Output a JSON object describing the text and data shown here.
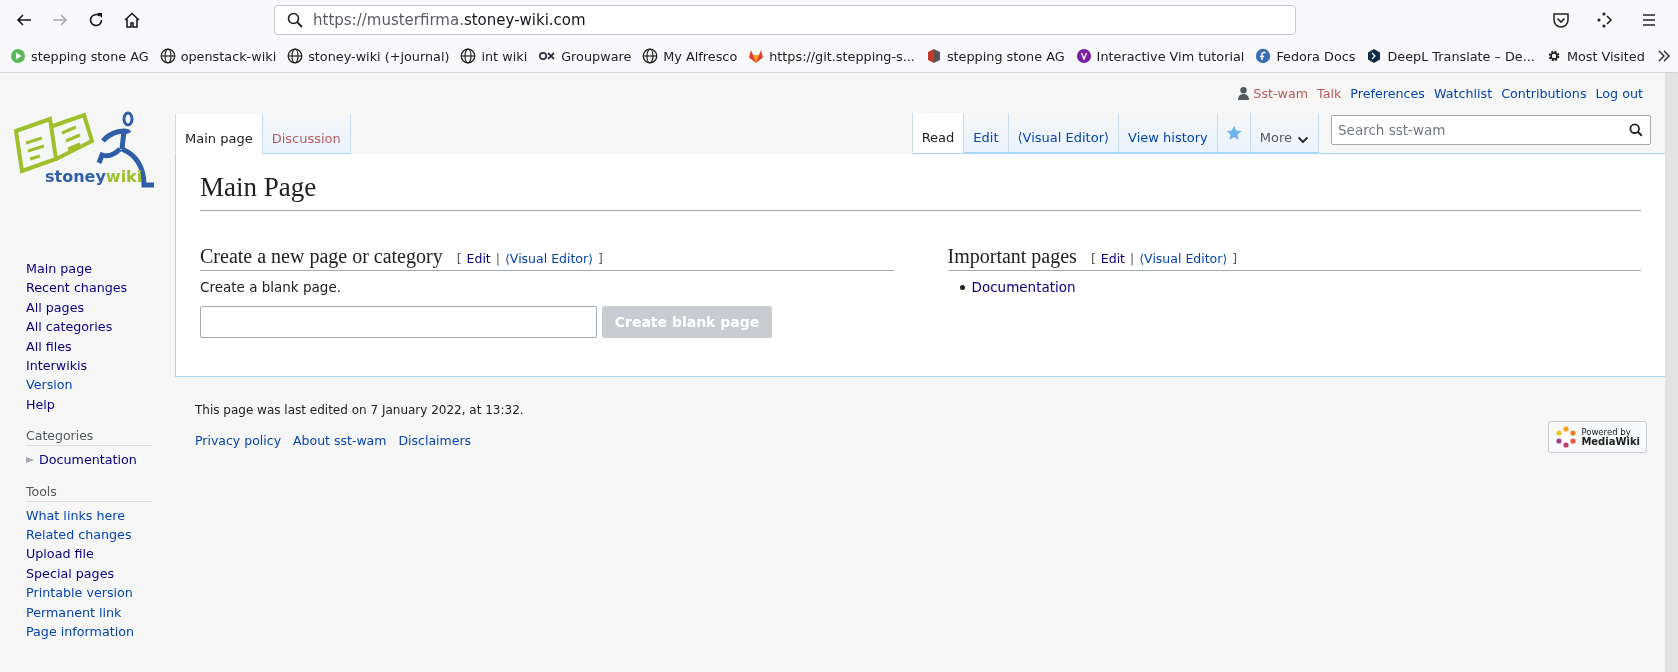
{
  "browser": {
    "nav_buttons": [
      {
        "kind": "back",
        "disabled": false
      },
      {
        "kind": "forward",
        "disabled": true
      },
      {
        "kind": "reload",
        "disabled": false
      },
      {
        "kind": "home",
        "disabled": false
      }
    ],
    "address": {
      "prefix": "https://musterfirma.",
      "domain": "stoney-wiki.com"
    },
    "toolbar_icons": [
      {
        "kind": "pocket"
      },
      {
        "kind": "extensions"
      },
      {
        "kind": "menu"
      }
    ],
    "bookmarks": [
      {
        "kind": "play",
        "label": "stepping stone AG"
      },
      {
        "kind": "globe",
        "label": "openstack-wiki"
      },
      {
        "kind": "globe",
        "label": "stoney-wiki (+journal)"
      },
      {
        "kind": "globe",
        "label": "int wiki"
      },
      {
        "kind": "ox",
        "label": "Groupware"
      },
      {
        "kind": "globe",
        "label": "My Alfresco"
      },
      {
        "kind": "fox",
        "label": "https://git.stepping-s..."
      },
      {
        "kind": "cube",
        "label": "stepping stone AG"
      },
      {
        "kind": "vim",
        "label": "Interactive Vim tutorial"
      },
      {
        "kind": "fedora",
        "label": "Fedora Docs"
      },
      {
        "kind": "deepl",
        "label": "DeepL Translate – De..."
      },
      {
        "kind": "gear",
        "label": "Most Visited"
      }
    ]
  },
  "logo": {
    "part_1": "stoney",
    "part_2": "wiki"
  },
  "personal_tools": [
    {
      "label": "Sst-wam",
      "new": true,
      "kind": "user"
    },
    {
      "label": "Talk",
      "new": true,
      "kind": "link"
    },
    {
      "label": "Preferences",
      "new": false,
      "kind": "link"
    },
    {
      "label": "Watchlist",
      "new": false,
      "kind": "link"
    },
    {
      "label": "Contributions",
      "new": false,
      "kind": "link"
    },
    {
      "label": "Log out",
      "new": false,
      "kind": "link"
    }
  ],
  "namespace_tabs": [
    {
      "label": "Main page",
      "selected": true,
      "new": false
    },
    {
      "label": "Discussion",
      "selected": false,
      "new": true
    }
  ],
  "view_tabs": [
    {
      "kind": "text",
      "label": "Read",
      "selected": true
    },
    {
      "kind": "text",
      "label": "Edit",
      "selected": false
    },
    {
      "kind": "text",
      "label": "⟨Visual Editor⟩",
      "selected": false
    },
    {
      "kind": "text",
      "label": "View history",
      "selected": false
    },
    {
      "kind": "star",
      "selected": false
    },
    {
      "kind": "menu",
      "label": "More",
      "selected": false
    }
  ],
  "search": {
    "placeholder": "Search sst-wam"
  },
  "sidebar": {
    "navigation": [
      {
        "label": "Main page",
        "visited": true
      },
      {
        "label": "Recent changes",
        "visited": true
      },
      {
        "label": "All pages",
        "visited": true
      },
      {
        "label": "All categories",
        "visited": true
      },
      {
        "label": "All files",
        "visited": true
      },
      {
        "label": "Interwikis",
        "visited": true
      },
      {
        "label": "Version",
        "visited": false
      },
      {
        "label": "Help",
        "visited": true
      }
    ],
    "portals": [
      {
        "heading": "Categories",
        "items": [
          {
            "label": "Documentation",
            "visited": true,
            "kind": "category"
          }
        ]
      },
      {
        "heading": "Tools",
        "items": [
          {
            "label": "What links here",
            "visited": false,
            "kind": "link"
          },
          {
            "label": "Related changes",
            "visited": false,
            "kind": "link"
          },
          {
            "label": "Upload file",
            "visited": true,
            "kind": "link"
          },
          {
            "label": "Special pages",
            "visited": true,
            "kind": "link"
          },
          {
            "label": "Printable version",
            "visited": false,
            "kind": "link"
          },
          {
            "label": "Permanent link",
            "visited": false,
            "kind": "link"
          },
          {
            "label": "Page information",
            "visited": false,
            "kind": "link"
          }
        ]
      }
    ]
  },
  "content": {
    "title": "Main Page",
    "sections": [
      {
        "heading": "Create a new page or category",
        "bracket_open": "[",
        "edit": "Edit",
        "separator": "|",
        "visual_edit": "⟨Visual Editor⟩",
        "bracket_close": "]",
        "kind": "create",
        "text": "Create a blank page.",
        "button": {
          "label": "Create blank page",
          "disabled": true
        }
      },
      {
        "heading": "Important pages",
        "bracket_open": "[",
        "edit": "Edit",
        "separator": "|",
        "visual_edit": "⟨Visual Editor⟩",
        "bracket_close": "]",
        "kind": "list",
        "items": [
          {
            "label": "Documentation",
            "visited": true
          }
        ]
      }
    ]
  },
  "footer": {
    "last_edited": "This page was last edited on 7 January 2022, at 13:32.",
    "links": [
      "Privacy policy",
      "About sst-wam",
      "Disclaimers"
    ],
    "badge": {
      "line_1": "Powered by",
      "line_2": "MediaWiki"
    }
  }
}
